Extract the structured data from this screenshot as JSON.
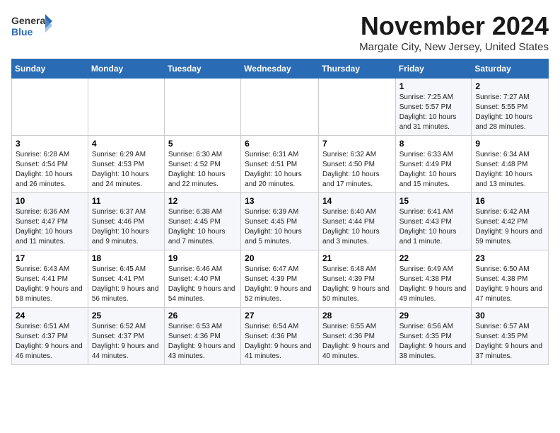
{
  "logo": {
    "general": "General",
    "blue": "Blue"
  },
  "header": {
    "month": "November 2024",
    "location": "Margate City, New Jersey, United States"
  },
  "weekdays": [
    "Sunday",
    "Monday",
    "Tuesday",
    "Wednesday",
    "Thursday",
    "Friday",
    "Saturday"
  ],
  "weeks": [
    [
      {
        "day": "",
        "info": ""
      },
      {
        "day": "",
        "info": ""
      },
      {
        "day": "",
        "info": ""
      },
      {
        "day": "",
        "info": ""
      },
      {
        "day": "",
        "info": ""
      },
      {
        "day": "1",
        "info": "Sunrise: 7:25 AM\nSunset: 5:57 PM\nDaylight: 10 hours and 31 minutes."
      },
      {
        "day": "2",
        "info": "Sunrise: 7:27 AM\nSunset: 5:55 PM\nDaylight: 10 hours and 28 minutes."
      }
    ],
    [
      {
        "day": "3",
        "info": "Sunrise: 6:28 AM\nSunset: 4:54 PM\nDaylight: 10 hours and 26 minutes."
      },
      {
        "day": "4",
        "info": "Sunrise: 6:29 AM\nSunset: 4:53 PM\nDaylight: 10 hours and 24 minutes."
      },
      {
        "day": "5",
        "info": "Sunrise: 6:30 AM\nSunset: 4:52 PM\nDaylight: 10 hours and 22 minutes."
      },
      {
        "day": "6",
        "info": "Sunrise: 6:31 AM\nSunset: 4:51 PM\nDaylight: 10 hours and 20 minutes."
      },
      {
        "day": "7",
        "info": "Sunrise: 6:32 AM\nSunset: 4:50 PM\nDaylight: 10 hours and 17 minutes."
      },
      {
        "day": "8",
        "info": "Sunrise: 6:33 AM\nSunset: 4:49 PM\nDaylight: 10 hours and 15 minutes."
      },
      {
        "day": "9",
        "info": "Sunrise: 6:34 AM\nSunset: 4:48 PM\nDaylight: 10 hours and 13 minutes."
      }
    ],
    [
      {
        "day": "10",
        "info": "Sunrise: 6:36 AM\nSunset: 4:47 PM\nDaylight: 10 hours and 11 minutes."
      },
      {
        "day": "11",
        "info": "Sunrise: 6:37 AM\nSunset: 4:46 PM\nDaylight: 10 hours and 9 minutes."
      },
      {
        "day": "12",
        "info": "Sunrise: 6:38 AM\nSunset: 4:45 PM\nDaylight: 10 hours and 7 minutes."
      },
      {
        "day": "13",
        "info": "Sunrise: 6:39 AM\nSunset: 4:45 PM\nDaylight: 10 hours and 5 minutes."
      },
      {
        "day": "14",
        "info": "Sunrise: 6:40 AM\nSunset: 4:44 PM\nDaylight: 10 hours and 3 minutes."
      },
      {
        "day": "15",
        "info": "Sunrise: 6:41 AM\nSunset: 4:43 PM\nDaylight: 10 hours and 1 minute."
      },
      {
        "day": "16",
        "info": "Sunrise: 6:42 AM\nSunset: 4:42 PM\nDaylight: 9 hours and 59 minutes."
      }
    ],
    [
      {
        "day": "17",
        "info": "Sunrise: 6:43 AM\nSunset: 4:41 PM\nDaylight: 9 hours and 58 minutes."
      },
      {
        "day": "18",
        "info": "Sunrise: 6:45 AM\nSunset: 4:41 PM\nDaylight: 9 hours and 56 minutes."
      },
      {
        "day": "19",
        "info": "Sunrise: 6:46 AM\nSunset: 4:40 PM\nDaylight: 9 hours and 54 minutes."
      },
      {
        "day": "20",
        "info": "Sunrise: 6:47 AM\nSunset: 4:39 PM\nDaylight: 9 hours and 52 minutes."
      },
      {
        "day": "21",
        "info": "Sunrise: 6:48 AM\nSunset: 4:39 PM\nDaylight: 9 hours and 50 minutes."
      },
      {
        "day": "22",
        "info": "Sunrise: 6:49 AM\nSunset: 4:38 PM\nDaylight: 9 hours and 49 minutes."
      },
      {
        "day": "23",
        "info": "Sunrise: 6:50 AM\nSunset: 4:38 PM\nDaylight: 9 hours and 47 minutes."
      }
    ],
    [
      {
        "day": "24",
        "info": "Sunrise: 6:51 AM\nSunset: 4:37 PM\nDaylight: 9 hours and 46 minutes."
      },
      {
        "day": "25",
        "info": "Sunrise: 6:52 AM\nSunset: 4:37 PM\nDaylight: 9 hours and 44 minutes."
      },
      {
        "day": "26",
        "info": "Sunrise: 6:53 AM\nSunset: 4:36 PM\nDaylight: 9 hours and 43 minutes."
      },
      {
        "day": "27",
        "info": "Sunrise: 6:54 AM\nSunset: 4:36 PM\nDaylight: 9 hours and 41 minutes."
      },
      {
        "day": "28",
        "info": "Sunrise: 6:55 AM\nSunset: 4:36 PM\nDaylight: 9 hours and 40 minutes."
      },
      {
        "day": "29",
        "info": "Sunrise: 6:56 AM\nSunset: 4:35 PM\nDaylight: 9 hours and 38 minutes."
      },
      {
        "day": "30",
        "info": "Sunrise: 6:57 AM\nSunset: 4:35 PM\nDaylight: 9 hours and 37 minutes."
      }
    ]
  ]
}
